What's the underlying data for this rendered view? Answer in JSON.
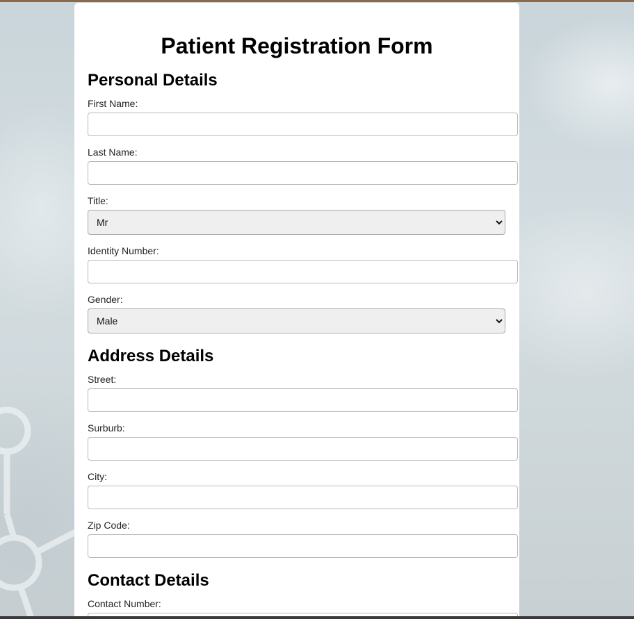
{
  "form": {
    "title": "Patient Registration Form",
    "sections": {
      "personal": {
        "heading": "Personal Details",
        "first_name_label": "First Name:",
        "last_name_label": "Last Name:",
        "title_label": "Title:",
        "title_selected": "Mr",
        "identity_label": "Identity Number:",
        "gender_label": "Gender:",
        "gender_selected": "Male"
      },
      "address": {
        "heading": "Address Details",
        "street_label": "Street:",
        "suburb_label": "Surburb:",
        "city_label": "City:",
        "zip_label": "Zip Code:"
      },
      "contact": {
        "heading": "Contact Details",
        "contact_number_label": "Contact Number:"
      }
    }
  },
  "colors": {
    "top_bar": "#8a6a4a",
    "card_background": "#ffffff",
    "select_background": "#efefef"
  }
}
